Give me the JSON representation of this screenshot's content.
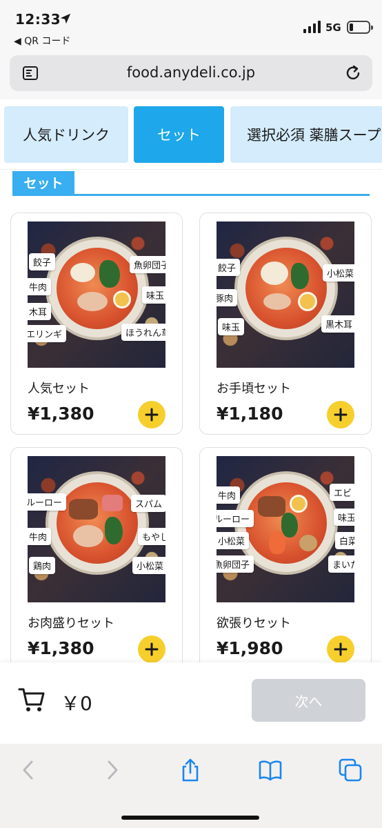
{
  "status_bar": {
    "time": "12:33",
    "back_app": "◀ QR コード",
    "network": "5G",
    "battery_level": 0.2
  },
  "address_bar": {
    "url": "food.anydeli.co.jp"
  },
  "tabs": [
    {
      "label": "人気ドリンク",
      "active": false
    },
    {
      "label": "セット",
      "active": true
    },
    {
      "label": "選択必須 薬膳スープ",
      "active": false
    }
  ],
  "section": {
    "title": "セット"
  },
  "products": [
    {
      "name": "人気セット",
      "price": "¥1,380",
      "tags": [
        "餃子",
        "牛肉",
        "木耳",
        "エリンギ",
        "魚卵団子",
        "味玉",
        "ほうれん草"
      ]
    },
    {
      "name": "お手頃セット",
      "price": "¥1,180",
      "tags": [
        "餃子",
        "豚肉",
        "味玉",
        "小松菜",
        "黒木耳"
      ]
    },
    {
      "name": "お肉盛りセット",
      "price": "¥1,380",
      "tags": [
        "ルーロー",
        "牛肉",
        "鶏肉",
        "スパム",
        "もやし",
        "小松菜"
      ]
    },
    {
      "name": "欲張りセット",
      "price": "¥1,980",
      "tags": [
        "牛肉",
        "ルーロー",
        "小松菜",
        "魚卵団子",
        "エビ",
        "味玉",
        "白菜",
        "まいたけ"
      ]
    }
  ],
  "cart": {
    "total": "￥0",
    "next_label": "次へ"
  },
  "colors": {
    "accent": "#1ea7ea",
    "tab_inactive": "#d4ecfb",
    "add_button": "#f6cf2d",
    "next_disabled": "#cfd2d6"
  }
}
